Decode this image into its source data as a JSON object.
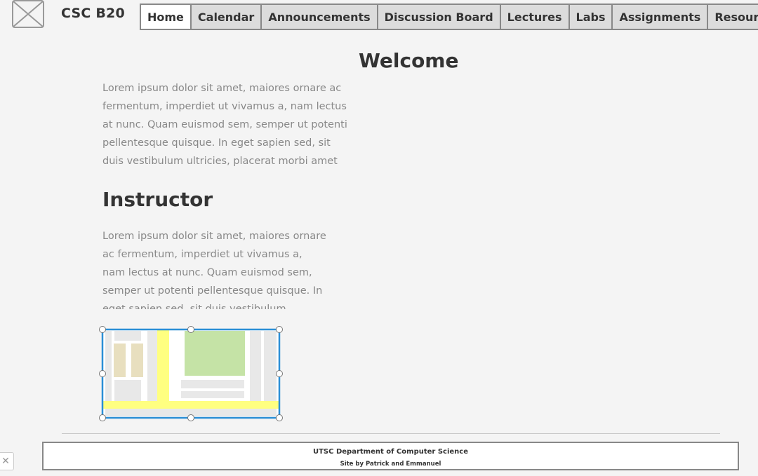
{
  "site": {
    "title": "CSC B20"
  },
  "nav": {
    "items": [
      {
        "label": "Home",
        "active": true
      },
      {
        "label": "Calendar",
        "active": false
      },
      {
        "label": "Announcements",
        "active": false
      },
      {
        "label": "Discussion Board",
        "active": false
      },
      {
        "label": "Lectures",
        "active": false
      },
      {
        "label": "Labs",
        "active": false
      },
      {
        "label": "Assignments",
        "active": false
      },
      {
        "label": "Resources",
        "active": false
      }
    ]
  },
  "main": {
    "welcome_heading": "Welcome",
    "welcome_text": "Lorem ipsum dolor sit amet, maiores ornare ac fermentum, imperdiet ut vivamus a, nam lectus at nunc. Quam euismod sem, semper ut potenti pellentesque quisque. In eget sapien sed, sit duis vestibulum ultricies, placerat morbi amet",
    "instructor_heading": "Instructor",
    "instructor_text": "Lorem ipsum dolor sit amet, maiores ornare ac fermentum, imperdiet ut vivamus a, nam lectus at nunc. Quam euismod sem, semper ut potenti pellentesque quisque. In eget sapien sed, sit duis vestibulum ultricies"
  },
  "footer": {
    "line1": "UTSC Department of Computer Science",
    "line2": "Site by Patrick and Emmanuel"
  },
  "colors": {
    "map_selection": "#2b8fd6",
    "map_road_yellow": "#ffff80",
    "map_park_green": "#c5e3a6",
    "map_building_tan": "#e8dfbf",
    "map_block_gray": "#e8e8e8"
  },
  "icons": {
    "logo": "image-placeholder-icon",
    "close": "close-icon"
  }
}
